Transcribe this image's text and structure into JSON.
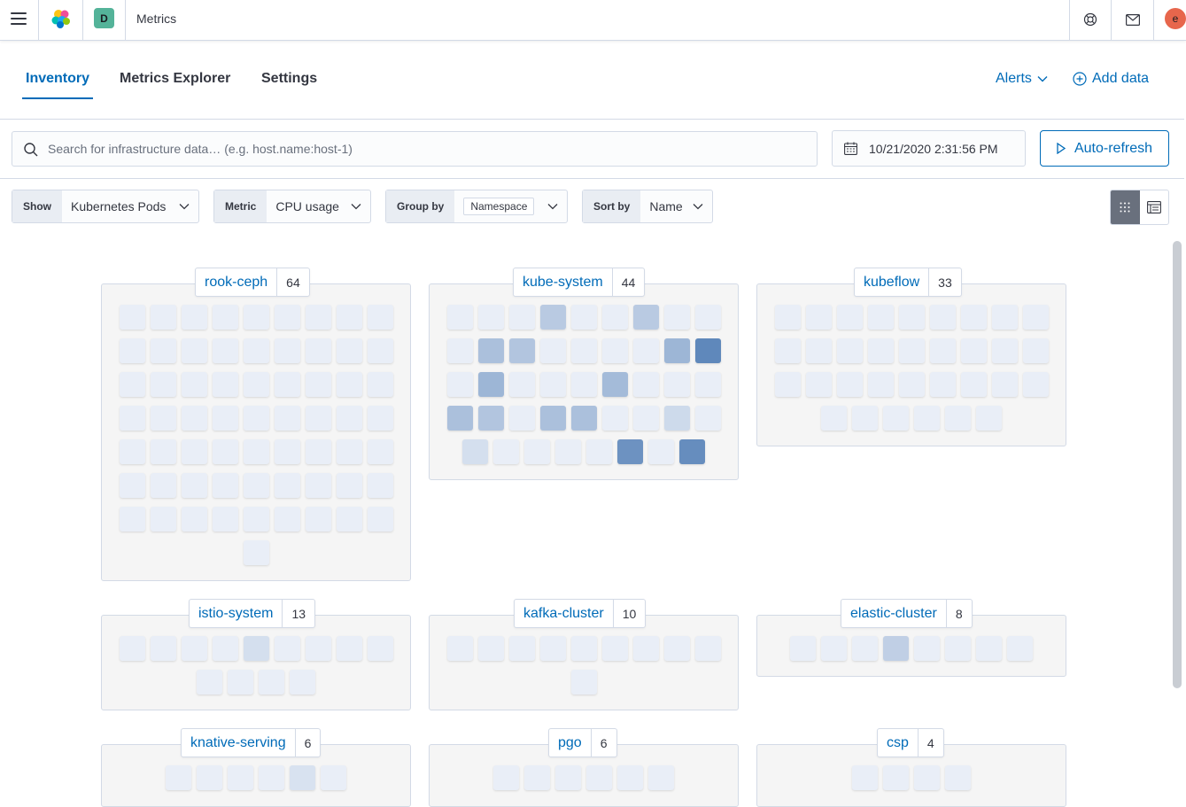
{
  "header": {
    "menu_icon": "hamburger-icon",
    "logo_icon": "elastic-logo-icon",
    "space_letter": "D",
    "app_title": "Metrics",
    "help_icon": "help-icon",
    "news_icon": "mail-icon",
    "user_initial": "e"
  },
  "tabs": [
    {
      "label": "Inventory",
      "active": true
    },
    {
      "label": "Metrics Explorer",
      "active": false
    },
    {
      "label": "Settings",
      "active": false
    }
  ],
  "header_links": {
    "alerts": "Alerts",
    "add_data": "Add data"
  },
  "search": {
    "placeholder": "Search for infrastructure data… (e.g. host.name:host-1)"
  },
  "date": {
    "value": "10/21/2020 2:31:56 PM"
  },
  "auto_refresh": {
    "label": "Auto-refresh"
  },
  "controls": {
    "show": {
      "label": "Show",
      "value": "Kubernetes Pods"
    },
    "metric": {
      "label": "Metric",
      "value": "CPU usage"
    },
    "group_by": {
      "label": "Group by",
      "value": "Namespace"
    },
    "sort_by": {
      "label": "Sort by",
      "value": "Name"
    }
  },
  "colors": {
    "accent": "#006bb8",
    "low": "#e9eef7",
    "high": "#5f88bb"
  },
  "groups": [
    {
      "name": "rook-ceph",
      "count": "64",
      "levels": [
        0,
        0,
        0,
        0,
        0,
        0,
        0,
        0,
        0,
        0,
        0,
        0,
        0,
        0,
        0,
        0,
        0,
        0,
        0,
        0,
        0,
        0,
        0,
        0,
        0,
        0,
        0,
        0,
        0,
        0,
        0,
        0,
        0,
        0,
        0,
        0,
        0,
        0,
        0,
        0,
        0,
        0,
        0,
        0,
        0,
        0,
        0,
        0,
        0,
        0,
        0,
        0,
        0,
        0,
        0,
        0,
        0,
        0,
        0,
        0,
        0,
        0,
        0,
        0
      ]
    },
    {
      "name": "kube-system",
      "count": "44",
      "levels": [
        0,
        0,
        0,
        0.35,
        0,
        0,
        0.35,
        0,
        0,
        0,
        0.45,
        0.4,
        0,
        0,
        0,
        0,
        0.55,
        1,
        0,
        0.55,
        0,
        0,
        0,
        0.5,
        0,
        0,
        0,
        0.45,
        0.4,
        0,
        0.45,
        0.45,
        0,
        0,
        0.2,
        0,
        0.15,
        0,
        0,
        0,
        0,
        0.9,
        0,
        0.95
      ]
    },
    {
      "name": "kubeflow",
      "count": "33",
      "levels": [
        0,
        0,
        0,
        0,
        0,
        0,
        0,
        0,
        0,
        0,
        0,
        0,
        0,
        0,
        0,
        0,
        0,
        0,
        0,
        0,
        0,
        0,
        0,
        0,
        0,
        0,
        0,
        0,
        0,
        0,
        0,
        0,
        0
      ]
    },
    {
      "name": "istio-system",
      "count": "13",
      "levels": [
        0,
        0,
        0,
        0,
        0.15,
        0,
        0,
        0,
        0,
        0,
        0,
        0,
        0
      ]
    },
    {
      "name": "kafka-cluster",
      "count": "10",
      "levels": [
        0,
        0,
        0,
        0,
        0,
        0,
        0,
        0,
        0,
        0
      ]
    },
    {
      "name": "elastic-cluster",
      "count": "8",
      "levels": [
        0,
        0,
        0,
        0.3,
        0,
        0,
        0,
        0
      ]
    },
    {
      "name": "knative-serving",
      "count": "6",
      "levels": [
        0,
        0,
        0,
        0,
        0.12,
        0
      ]
    },
    {
      "name": "pgo",
      "count": "6",
      "levels": [
        0,
        0,
        0,
        0,
        0,
        0
      ]
    },
    {
      "name": "csp",
      "count": "4",
      "levels": [
        0,
        0,
        0,
        0
      ]
    }
  ]
}
